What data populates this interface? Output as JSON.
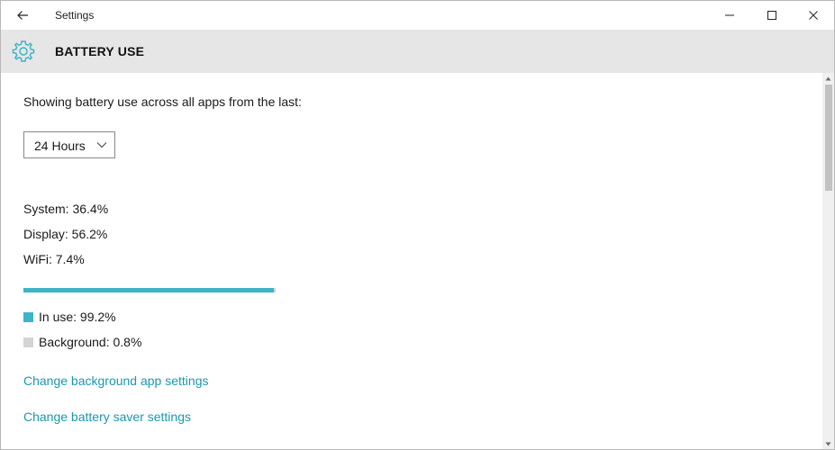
{
  "window": {
    "title": "Settings"
  },
  "header": {
    "title": "BATTERY USE",
    "icon": "gear-icon"
  },
  "intro_text": "Showing battery use across all apps from the last:",
  "period_select": {
    "selected": "24 Hours"
  },
  "stats": [
    {
      "label": "System: 36.4%"
    },
    {
      "label": "Display: 56.2%"
    },
    {
      "label": "WiFi: 7.4%"
    }
  ],
  "usage_bar": {
    "in_use_fraction": 0.992,
    "in_use_color": "#3fb4c5",
    "background_color": "#d4d4d4"
  },
  "legend": {
    "in_use": "In use: 99.2%",
    "background": "Background: 0.8%"
  },
  "links": {
    "background_apps": "Change background app settings",
    "battery_saver": "Change battery saver settings"
  },
  "colors": {
    "accent": "#1b97ad",
    "header_bg": "#e6e6e6"
  }
}
